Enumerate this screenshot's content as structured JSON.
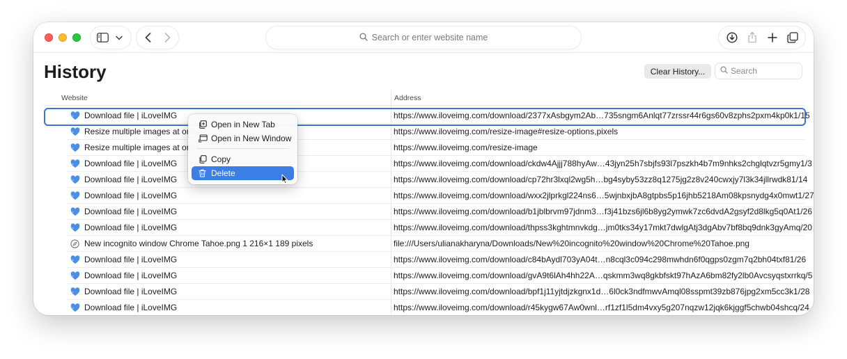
{
  "toolbar": {
    "address_placeholder": "Search or enter website name"
  },
  "page": {
    "title": "History",
    "clear_history_label": "Clear History...",
    "search_placeholder": "Search"
  },
  "table": {
    "columns": {
      "website": "Website",
      "address": "Address"
    },
    "rows": [
      {
        "title": "Download file | iLoveIMG",
        "address": "https://www.iloveimg.com/download/2377xAsbgym2Ab…735sngm6Anlqt77zrssr44r6gs60v8zphs2pxm4kp0k1/15",
        "icon": "iloveimg-heart-icon"
      },
      {
        "title": "Resize multiple images at once",
        "address": "https://www.iloveimg.com/resize-image#resize-options,pixels",
        "icon": "iloveimg-heart-icon"
      },
      {
        "title": "Resize multiple images at once",
        "address": "https://www.iloveimg.com/resize-image",
        "icon": "iloveimg-heart-icon"
      },
      {
        "title": "Download file | iLoveIMG",
        "address": "https://www.iloveimg.com/download/ckdw4Ajjj788hyAw…43jyn25h7sbjfs93l7pszkh4b7m9nhks2chglqtvzr5gmy1/3",
        "icon": "iloveimg-heart-icon"
      },
      {
        "title": "Download file | iLoveIMG",
        "address": "https://www.iloveimg.com/download/cp72hr3lxql2wg5h…bg4syby53zz8q1275jg2z8v240cwxjy7l3k34jllrwdk81/14",
        "icon": "iloveimg-heart-icon"
      },
      {
        "title": "Download file | iLoveIMG",
        "address": "https://www.iloveimg.com/download/wxx2jlprkgl224ns6…5wjnbxjbA8gtpbs5p16jhb5218Am08kpsnydg4x0mwt1/27",
        "icon": "iloveimg-heart-icon"
      },
      {
        "title": "Download file | iLoveIMG",
        "address": "https://www.iloveimg.com/download/b1jblbrvm97jdnm3…f3j41bzs6jl6b8yg2ymwk7zc6dvdA2gsyf2d8lkg5q0At1/26",
        "icon": "iloveimg-heart-icon"
      },
      {
        "title": "Download file | iLoveIMG",
        "address": "https://www.iloveimg.com/download/thpss3kghtmnvkdg…jm0tks34y17mkt7dwlgAtj3dgAbv7bf8bq9dnk3gyAmq/20",
        "icon": "iloveimg-heart-icon"
      },
      {
        "title": "New incognito window Chrome Tahoe.png 1 216×1 189 pixels",
        "address": "file:///Users/ulianakharyna/Downloads/New%20incognito%20window%20Chrome%20Tahoe.png",
        "icon": "compass-icon"
      },
      {
        "title": "Download file | iLoveIMG",
        "address": "https://www.iloveimg.com/download/c84bAydl703yA04t…n8cql3c094c298mwhdn6f0qgps0zgm7q2bh04txf81/26",
        "icon": "iloveimg-heart-icon"
      },
      {
        "title": "Download file | iLoveIMG",
        "address": "https://www.iloveimg.com/download/gvA9t6lAh4hh22A…qskmm3wq8gkbfskt97hAzA6bm82fy2lb0Avcsyqstxrrkq/5",
        "icon": "iloveimg-heart-icon"
      },
      {
        "title": "Download file | iLoveIMG",
        "address": "https://www.iloveimg.com/download/bpf1j11yjtdjzkgnx1d…6l0ck3ndfmwvAmql08sspmt39zb876jpg2xm5cc3k1/28",
        "icon": "iloveimg-heart-icon"
      },
      {
        "title": "Download file | iLoveIMG",
        "address": "https://www.iloveimg.com/download/r45kygw67Aw0wnl…rf1zf1l5dm4vxy5g207nqzw12jqk6kjggf5chwb04shcq/24",
        "icon": "iloveimg-heart-icon"
      }
    ]
  },
  "context_menu": {
    "items": [
      {
        "label": "Open in New Tab",
        "icon": "new-tab-icon"
      },
      {
        "label": "Open in New Window",
        "icon": "new-window-icon"
      },
      {
        "label": "Copy",
        "icon": "copy-icon"
      },
      {
        "label": "Delete",
        "icon": "trash-icon"
      }
    ]
  },
  "colors": {
    "accent": "#3d7ee6",
    "focus_ring": "#3b73d6",
    "favicon": "#4a8ee6",
    "traffic_red": "#ff5f57",
    "traffic_yellow": "#febc2e",
    "traffic_green": "#28c840"
  }
}
